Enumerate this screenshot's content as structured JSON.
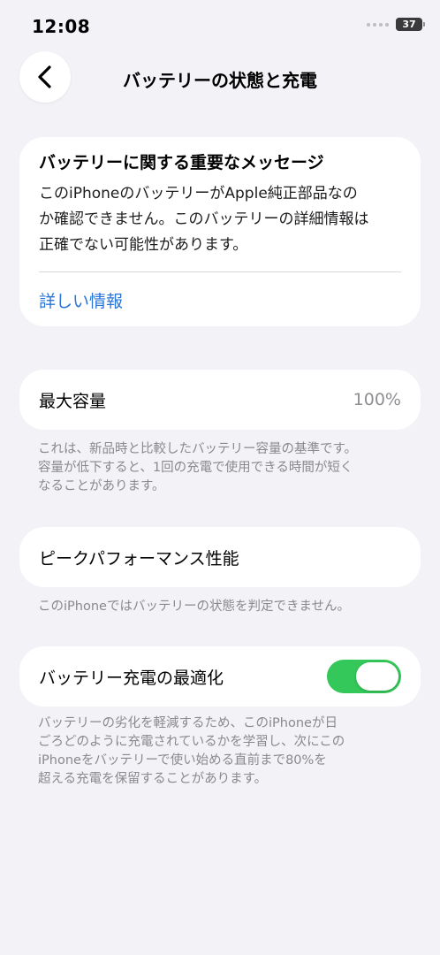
{
  "status_bar": {
    "time": "12:08",
    "battery_level": "37"
  },
  "nav": {
    "title": "バッテリーの状態と充電",
    "back_icon": "chevron-left-icon"
  },
  "message_card": {
    "title": "バッテリーに関する重要なメッセージ",
    "body_line1": "このiPhoneのバッテリーがApple純正部品なの",
    "body_line2": "か確認できません。このバッテリーの詳細情報は",
    "body_line3": "正確でない可能性があります。",
    "link": "詳しい情報"
  },
  "capacity": {
    "label": "最大容量",
    "value": "100%",
    "footnote_line1": "これは、新品時と比較したバッテリー容量の基準です。",
    "footnote_line2": "容量が低下すると、1回の充電で使用できる時間が短く",
    "footnote_line3": "なることがあります。"
  },
  "peak_performance": {
    "label": "ピークパフォーマンス性能",
    "footnote": "このiPhoneではバッテリーの状態を判定できません。"
  },
  "optimized_charging": {
    "label": "バッテリー充電の最適化",
    "enabled": true,
    "footnote_line1": "バッテリーの劣化を軽減するため、このiPhoneが日",
    "footnote_line2": "ごろどのように充電されているかを学習し、次にこの",
    "footnote_line3": "iPhoneをバッテリーで使い始める直前まで80%を",
    "footnote_line4": "超える充電を保留することがあります。"
  },
  "colors": {
    "accent_link": "#2a74d6",
    "toggle_on": "#34c759",
    "background": "#f2f2f7"
  }
}
